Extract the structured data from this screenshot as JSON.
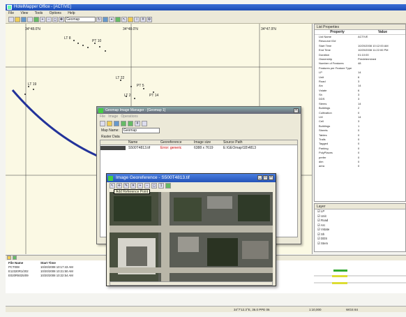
{
  "window": {
    "title": "HotelMapper Office - [ACTIVE]"
  },
  "menu": [
    "File",
    "View",
    "Tools",
    "Options",
    "Help"
  ],
  "toolbar": {
    "combo_value": "Geomap"
  },
  "map": {
    "labels": [
      "34°48.0'N",
      "34°48.0'N",
      "34°47.9'N"
    ],
    "track_labels": [
      "LT 8",
      "PT 10",
      "LT 19",
      "LT 22",
      "PT 5",
      "LT 2",
      "PT 14"
    ]
  },
  "properties": {
    "header": "List Properties",
    "col_property": "Property",
    "col_value": "Value",
    "rows": [
      [
        "List Name",
        "ACTIVE"
      ],
      [
        "Resource ID#",
        ""
      ],
      [
        "Start Time",
        "10/20/2008 10:12:00 AM"
      ],
      [
        "End Time",
        "10/20/2008 11:22:00 PM"
      ],
      [
        "Duration",
        "01:10:00"
      ],
      [
        "Ownership",
        "Predetermined"
      ],
      [
        "Number of Features",
        "48"
      ],
      [
        "Features per Feature Type",
        ""
      ],
      [
        "LP",
        "14"
      ],
      [
        "Unit",
        "6"
      ],
      [
        "Road",
        "3"
      ],
      [
        "Arc",
        "14"
      ],
      [
        "Vstate",
        "6"
      ],
      [
        "Sh",
        "3"
      ],
      [
        "DDS",
        "3"
      ],
      [
        "Stems",
        "14"
      ],
      [
        "Buildings",
        "2"
      ],
      [
        "Cultivation",
        "0"
      ],
      [
        "LM",
        "14"
      ],
      [
        "Cell",
        "3"
      ],
      [
        "Buildings",
        "1"
      ],
      [
        "Streets",
        "0"
      ],
      [
        "Tables",
        "0"
      ],
      [
        "Trails",
        "0"
      ],
      [
        "Tagged",
        "0"
      ],
      [
        "Parking",
        "0"
      ],
      [
        "PolyPlaces",
        "0"
      ],
      [
        "prefer",
        "0"
      ],
      [
        "dim",
        "0"
      ],
      [
        "area",
        "0"
      ]
    ]
  },
  "layers": {
    "header": "Layer",
    "items": [
      "LP",
      "Unit",
      "Road",
      "Arc",
      "Vstate",
      "Sh",
      "DDS",
      "Stem"
    ]
  },
  "bottom": {
    "col_file": "File Name",
    "col_start": "Start Time",
    "rows": [
      [
        "PCT008",
        "10/20/2008 10:17:43 AM"
      ],
      [
        "E12320R1/202",
        "10/20/2008 10:21:50 AM"
      ],
      [
        "E020R5025/09",
        "10/20/2008 10:22:54 AM"
      ]
    ]
  },
  "status": {
    "coords": "34°7'12.3°E, 36.0 PPE 06",
    "scale": "1:10,000",
    "misc": "WGS 84"
  },
  "wm_window": {
    "title": "Geomap Image Manager - [Geomap 1]",
    "menu": [
      "File",
      "Image",
      "Operations"
    ],
    "map_name_label": "Map Name:",
    "map_name_value": "Geomap",
    "raster_label": "Raster Data",
    "columns": [
      "Name",
      "Georeference",
      "Image size",
      "Source Path"
    ],
    "row": [
      "S500T4813.tif",
      "Error: generic",
      "6388 x 7619",
      "E:\\GEOmap\\S5\\4813"
    ]
  },
  "ig_window": {
    "title": "Image Georeference - S500T4813.tif",
    "tooltip": "Add Reference Point"
  }
}
